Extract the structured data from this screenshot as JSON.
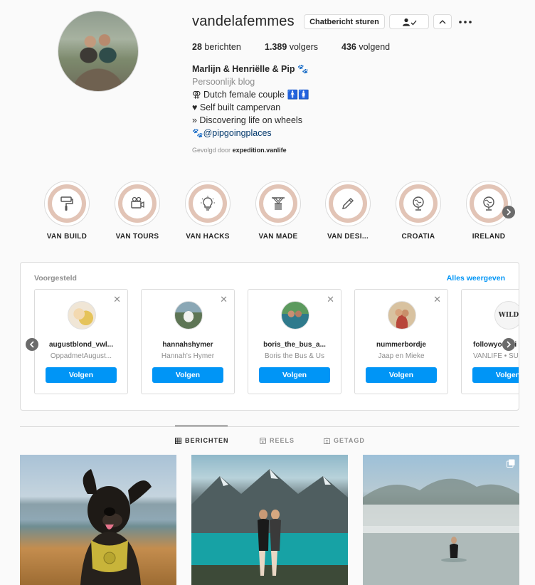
{
  "profile": {
    "username": "vandelafemmes",
    "message_button": "Chatbericht sturen",
    "stats": {
      "posts_count": "28",
      "posts_label": "berichten",
      "followers_count": "1.389",
      "followers_label": "volgers",
      "following_count": "436",
      "following_label": "volgend"
    },
    "bio": {
      "name": "Marlijn & Henriëlle & Pip 🐾",
      "category": "Persoonlijk blog",
      "line1": "⚢ Dutch female couple 🚹🚺",
      "line2": "♥ Self built campervan",
      "line3": "» Discovering life on wheels",
      "link": "🐾@pipgoingplaces"
    },
    "followed_by_prefix": "Gevolgd door",
    "followed_by_user": "expedition.vanlife"
  },
  "highlights": [
    {
      "label": "VAN BUILD",
      "icon": "paint-roller-icon"
    },
    {
      "label": "VAN TOURS",
      "icon": "video-camera-icon"
    },
    {
      "label": "VAN HACKS",
      "icon": "lightbulb-icon"
    },
    {
      "label": "VAN MADE",
      "icon": "macrame-icon"
    },
    {
      "label": "VAN DESI...",
      "icon": "pencil-icon"
    },
    {
      "label": "CROATIA",
      "icon": "globe-icon"
    },
    {
      "label": "IRELAND",
      "icon": "globe-icon"
    }
  ],
  "suggestions": {
    "title": "Voorgesteld",
    "see_all": "Alles weergeven",
    "follow_label": "Volgen",
    "cards": [
      {
        "username": "augustblond_vwl...",
        "fullname": "OppadmetAugust...",
        "color": "#e8c88a"
      },
      {
        "username": "hannahshymer",
        "fullname": "Hannah's Hymer",
        "color": "#7f8f88"
      },
      {
        "username": "boris_the_bus_a...",
        "fullname": "Boris the Bus & Us",
        "color": "#3d7f8c"
      },
      {
        "username": "nummerbordje",
        "fullname": "Jaap en Mieke",
        "color": "#c9a27a"
      },
      {
        "username": "followyourwi",
        "fullname": "VANLIFE • SU",
        "color": "#f2f2f2"
      }
    ]
  },
  "tabs": {
    "posts": "BERICHTEN",
    "reels": "REELS",
    "tagged": "GETAGD"
  }
}
